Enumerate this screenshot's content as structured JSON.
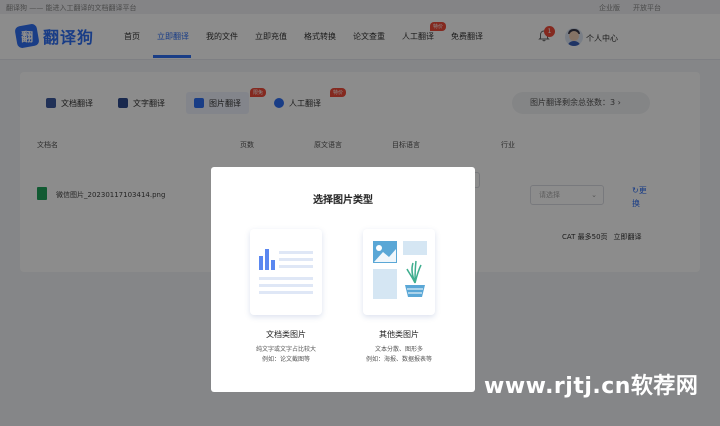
{
  "topbar": {
    "tagline": "翻译狗 —— 能进入工翻译的文档翻译平台",
    "links": [
      "企业版",
      "开放平台"
    ]
  },
  "header": {
    "logo_glyph": "翻",
    "logo_text": "翻译狗",
    "nav": [
      "首页",
      "立即翻译",
      "我的文件",
      "立即充值",
      "格式转换",
      "论文查重",
      "人工翻译",
      "免费翻译"
    ],
    "active_nav": "立即翻译",
    "nav_badge": "特价",
    "notification_count": "1",
    "user_center": "个人中心"
  },
  "card": {
    "tabs": [
      "文档翻译",
      "文字翻译",
      "图片翻译",
      "人工翻译"
    ],
    "active_tab": "图片翻译",
    "tab_badges": {
      "image": "限免",
      "human": "特价"
    },
    "remaining": "图片翻译剩余总张数：3",
    "columns": [
      "文档名",
      "页数",
      "原文语言",
      "目标语言",
      "行业"
    ],
    "file_name": "微信图片_20230117103414.png",
    "select_placeholder": "请选择",
    "swap_label": "更换",
    "cat_info": "CAT 最多50页",
    "translate_button": "立即翻译"
  },
  "modal": {
    "title": "选择图片类型",
    "options": [
      {
        "label": "文档类图片",
        "desc1": "纯文字或文字占比较大",
        "desc2": "例如：论文截图等"
      },
      {
        "label": "其他类图片",
        "desc1": "文本分散、图形多",
        "desc2": "例如：海报、数据报表等"
      }
    ]
  },
  "watermark": "www.rjtj.cn软荐网",
  "colors": {
    "brand": "#2f6ff5",
    "badge": "#f04b3a",
    "file_green": "#1fa45c"
  }
}
